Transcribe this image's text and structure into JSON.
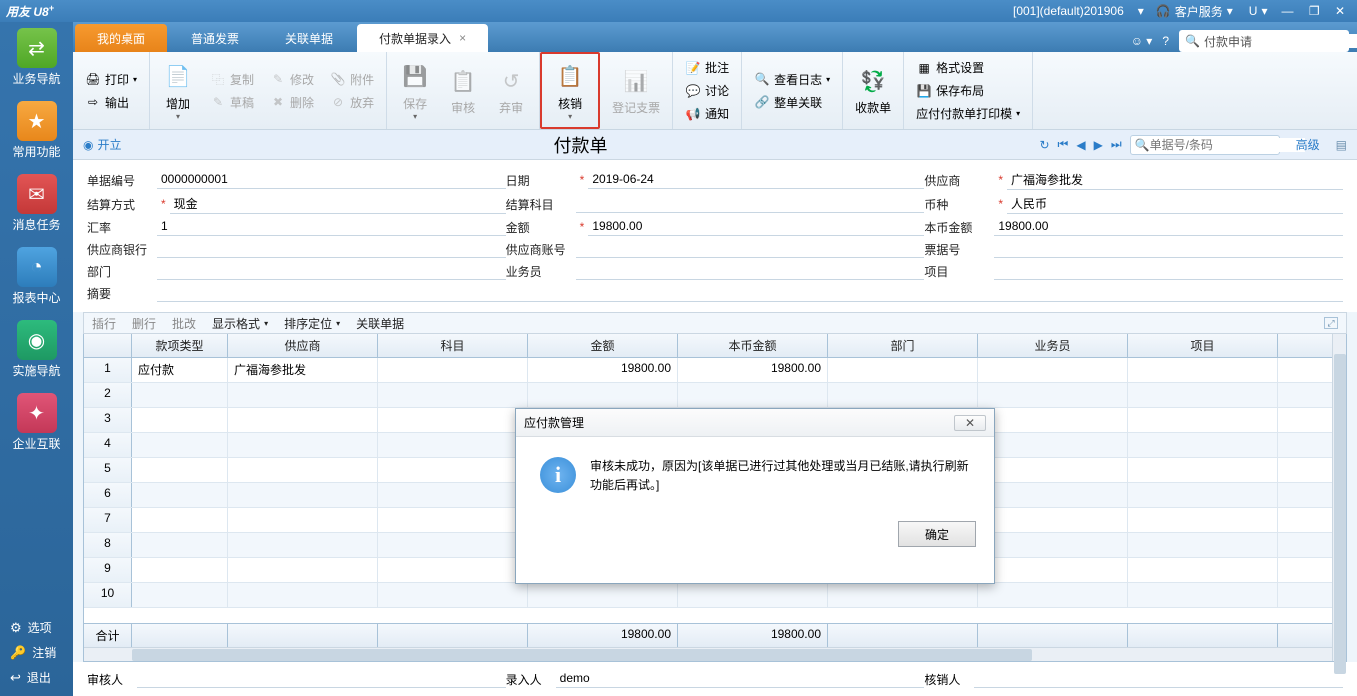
{
  "titlebar": {
    "app_name": "用友 U8",
    "sup": "+",
    "account": "[001](default)201906",
    "service": "客户服务",
    "u": "U"
  },
  "tabs": {
    "items": [
      {
        "label": "我的桌面",
        "type": "orange"
      },
      {
        "label": "普通发票",
        "type": "blue"
      },
      {
        "label": "关联单据",
        "type": "blue"
      },
      {
        "label": "付款单据录入",
        "type": "active"
      }
    ],
    "search_value": "付款申请"
  },
  "ribbon": {
    "print": "打印",
    "output": "输出",
    "add": "增加",
    "copy": "复制",
    "draft": "草稿",
    "modify": "修改",
    "delete": "删除",
    "attach": "附件",
    "abandon": "放弃",
    "save": "保存",
    "audit": "审核",
    "un_audit": "弃审",
    "verify": "核销",
    "register": "登记支票",
    "note": "批注",
    "discuss": "讨论",
    "notify": "通知",
    "viewlog": "查看日志",
    "reorder": "整单关联",
    "receipt": "收款单",
    "format": "格式设置",
    "savelayout": "保存布局",
    "printtmpl": "应付付款单打印模"
  },
  "docbar": {
    "open": "开立",
    "title": "付款单",
    "search_placeholder": "单据号/条码",
    "advanced": "高级"
  },
  "form": {
    "doc_no_label": "单据编号",
    "doc_no": "0000000001",
    "date_label": "日期",
    "date": "2019-06-24",
    "supplier_label": "供应商",
    "supplier": "广福海参批发",
    "settle_label": "结算方式",
    "settle": "现金",
    "subject_label": "结算科目",
    "currency_label": "币种",
    "currency": "人民币",
    "rate_label": "汇率",
    "rate": "1",
    "amount_label": "金额",
    "amount": "19800.00",
    "local_amount_label": "本币金额",
    "local_amount": "19800.00",
    "bank_label": "供应商银行",
    "account_label": "供应商账号",
    "billno_label": "票据号",
    "dept_label": "部门",
    "person_label": "业务员",
    "project_label": "项目",
    "summary_label": "摘要"
  },
  "grid_toolbar": {
    "insert": "插行",
    "delete": "删行",
    "batch": "批改",
    "display": "显示格式",
    "sort": "排序定位",
    "related": "关联单据"
  },
  "grid": {
    "headers": [
      "",
      "款项类型",
      "供应商",
      "科目",
      "金额",
      "本币金额",
      "部门",
      "业务员",
      "项目"
    ],
    "rows": [
      {
        "n": "1",
        "type": "应付款",
        "supplier": "广福海参批发",
        "subject": "",
        "amount": "19800.00",
        "local": "19800.00",
        "dept": "",
        "person": "",
        "proj": ""
      },
      {
        "n": "2"
      },
      {
        "n": "3"
      },
      {
        "n": "4"
      },
      {
        "n": "5"
      },
      {
        "n": "6"
      },
      {
        "n": "7"
      },
      {
        "n": "8"
      },
      {
        "n": "9"
      },
      {
        "n": "10"
      }
    ],
    "total_label": "合计",
    "total_amount": "19800.00",
    "total_local": "19800.00"
  },
  "footer": {
    "auditor_label": "审核人",
    "entry_label": "录入人",
    "entry_by": "demo",
    "verifier_label": "核销人"
  },
  "sidebar": {
    "items": [
      {
        "label": "业务导航",
        "color": "ic-green",
        "glyph": "⇄"
      },
      {
        "label": "常用功能",
        "color": "ic-orange",
        "glyph": "★"
      },
      {
        "label": "消息任务",
        "color": "ic-red",
        "glyph": "✉"
      },
      {
        "label": "报表中心",
        "color": "ic-blue",
        "glyph": "◔"
      },
      {
        "label": "实施导航",
        "color": "ic-green2",
        "glyph": "◉"
      },
      {
        "label": "企业互联",
        "color": "ic-pink",
        "glyph": "✦"
      }
    ],
    "options": "选项",
    "logout": "注销",
    "exit": "退出"
  },
  "dialog": {
    "title": "应付款管理",
    "message": "审核未成功，原因为[该单据已进行过其他处理或当月已结账,请执行刷新功能后再试。]",
    "ok": "确定"
  }
}
